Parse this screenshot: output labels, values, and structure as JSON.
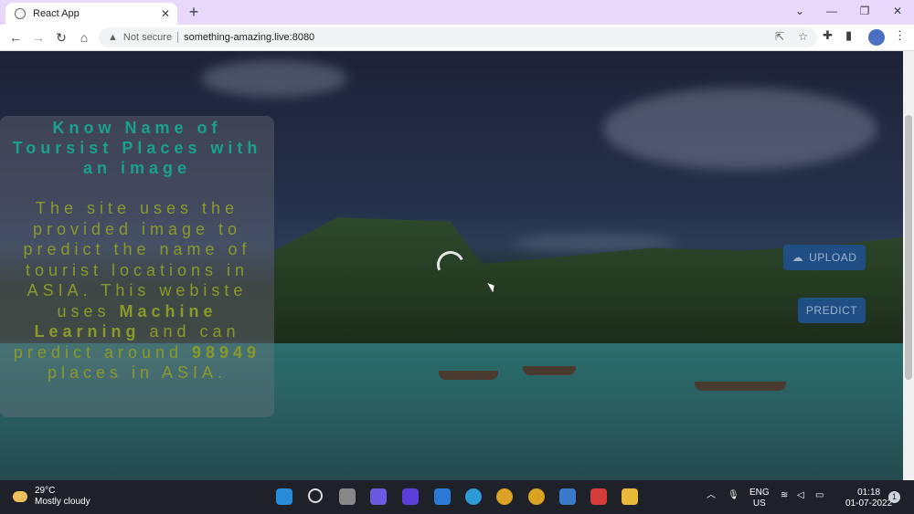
{
  "browser": {
    "tab_title": "React App",
    "address": {
      "security": "Not secure",
      "url": "something-amazing.live:8080"
    }
  },
  "page": {
    "heading": "Know Name of Toursist Places with an image",
    "description": {
      "part1": "The site uses the provided image to predict the name of tourist locations in ASIA. This webiste uses",
      "bold1": "Machine Learning",
      "part2": "and can predict around",
      "bold2": "98949",
      "part3": "places in ASIA."
    },
    "buttons": {
      "upload": "UPLOAD",
      "predict": "PREDICT"
    }
  },
  "taskbar": {
    "weather": {
      "temp": "29°C",
      "condition": "Mostly cloudy"
    },
    "language": {
      "line1": "ENG",
      "line2": "US"
    },
    "clock": {
      "time": "01:18",
      "date": "01-07-2022"
    },
    "notification_count": "1"
  },
  "colors": {
    "heading": "#1aa08d",
    "description": "#8a9a2a",
    "button_bg": "#1f4e85"
  }
}
